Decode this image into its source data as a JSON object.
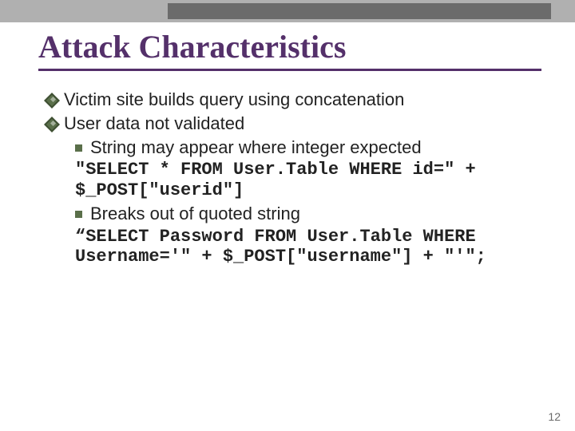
{
  "title": "Attack Characteristics",
  "bullets": {
    "b1": "Victim site builds query using concatenation",
    "b2": "User data not validated",
    "b2_1": "String may appear where integer expected",
    "code1": "\"SELECT * FROM User.Table WHERE id=\" + $_POST[\"userid\"]",
    "b2_2": "Breaks out of quoted string",
    "code2": "“SELECT Password FROM User.Table WHERE Username='\" + $_POST[\"username\"] + \"'\";"
  },
  "page_number": "12"
}
